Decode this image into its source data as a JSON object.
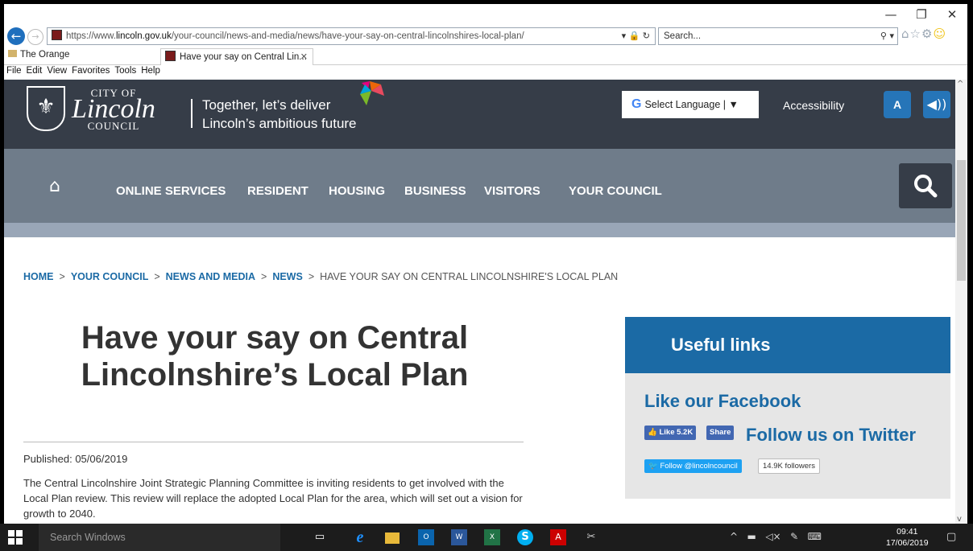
{
  "browser": {
    "url_prefix": "https://www.",
    "url_host": "lincoln.gov.uk",
    "url_path": "/your-council/news-and-media/news/have-your-say-on-central-lincolnshires-local-plan/",
    "url_controls": "▾ 🔒 ↻",
    "search_placeholder": "Search...",
    "tabs": [
      {
        "label": "The Orange"
      },
      {
        "label": "Have your say on Central Lin..."
      }
    ],
    "menu": [
      "File",
      "Edit",
      "View",
      "Favorites",
      "Tools",
      "Help"
    ],
    "window_controls": [
      "—",
      "❐",
      "✕"
    ]
  },
  "header": {
    "logo_top": "CITY OF",
    "logo_main": "Lincoln",
    "logo_bottom": "COUNCIL",
    "tagline_1": "Together, let’s deliver",
    "tagline_2": "Lincoln’s ambitious future",
    "language_label": "Select Language",
    "language_sep": "| ▼",
    "accessibility": "Accessibility",
    "font_button": "A"
  },
  "nav": {
    "items": [
      {
        "label": "ONLINE SERVICES"
      },
      {
        "label": "RESIDENT"
      },
      {
        "label": "HOUSING"
      },
      {
        "label": "BUSINESS"
      },
      {
        "label": "VISITORS"
      },
      {
        "label": "YOUR COUNCIL"
      }
    ]
  },
  "breadcrumb": {
    "items": [
      "HOME",
      "YOUR COUNCIL",
      "NEWS AND MEDIA",
      "NEWS"
    ],
    "separator": ">",
    "current": "HAVE YOUR SAY ON CENTRAL LINCOLNSHIRE'S LOCAL PLAN"
  },
  "article": {
    "title_line1": "Have your say on Central",
    "title_line2": "Lincolnshire’s Local Plan",
    "published": "Published: 05/06/2019",
    "body": "The Central Lincolnshire Joint Strategic Planning Committee is inviting residents to get involved with the Local Plan review. This review will replace the adopted Local Plan for the area, which will set out a vision for growth to 2040."
  },
  "sidebar": {
    "heading": "Useful links",
    "facebook_heading": "Like our Facebook",
    "fb_like": "Like 5.2K",
    "fb_share": "Share",
    "twitter_heading": "Follow us on Twitter",
    "tw_follow": "Follow @lincolncouncil",
    "tw_followers": "14.9K followers"
  },
  "taskbar": {
    "search_placeholder": "Search Windows",
    "time": "09:41",
    "date": "17/06/2019"
  },
  "colors": {
    "header_bg": "#363d48",
    "nav_bg": "#6f7c8a",
    "accent_blue": "#1b6aa5",
    "button_blue": "#2675b8"
  }
}
